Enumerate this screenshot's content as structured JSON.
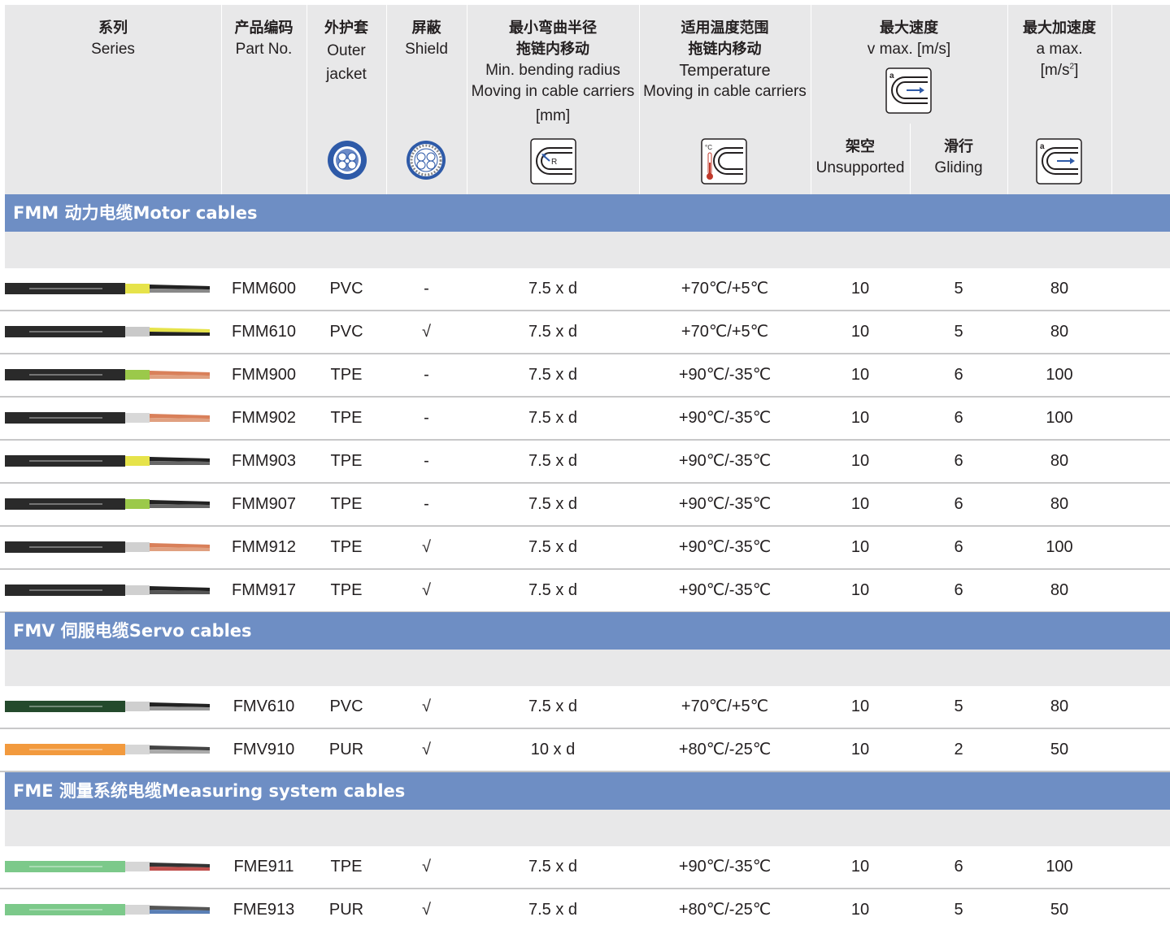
{
  "header": {
    "series": {
      "cn": "系列",
      "en": "Series"
    },
    "part_no": {
      "cn": "产品编码",
      "en": "Part No."
    },
    "outer_jacket": {
      "cn": "外护套",
      "en1": "Outer",
      "en2": "jacket"
    },
    "shield": {
      "cn": "屏蔽",
      "en": "Shield"
    },
    "bending": {
      "cn1": "最小弯曲半径",
      "cn2": "拖链内移动",
      "en1": "Min. bending radius",
      "en2": "Moving in cable carriers",
      "en3": "[mm]"
    },
    "temperature": {
      "cn1": "适用温度范围",
      "cn2": "拖链内移动",
      "en1": "Temperature",
      "en2": "Moving in cable carriers"
    },
    "speed": {
      "cn": "最大速度",
      "en": "v max. [m/s]",
      "unsupported_cn": "架空",
      "unsupported_en": "Unsupported",
      "gliding_cn": "滑行",
      "gliding_en": "Gliding"
    },
    "accel": {
      "cn": "最大加速度",
      "en1": "a max.",
      "en2_a": "[m/s",
      "en2_sup": "2",
      "en2_b": "]"
    }
  },
  "icons": {
    "outer_jacket": "cable-cross-section-icon",
    "shield": "shielded-cable-cross-section-icon",
    "bending": "bending-radius-icon",
    "temperature": "thermometer-cable-carrier-icon",
    "speed": "speed-cable-carrier-icon",
    "accel": "acceleration-cable-carrier-icon",
    "icon_letter_a": "a",
    "icon_letter_r": "R",
    "icon_unit_c": "°C"
  },
  "colors": {
    "header_bg": "#e8e8e9",
    "section_bg": "#6e8ec4",
    "row_separator": "#c8c8c9",
    "icon_blue": "#2e5aa8"
  },
  "sections": [
    {
      "title": "FMM 动力电缆Motor cables",
      "rows": [
        {
          "part": "FMM600",
          "jacket": "PVC",
          "shield": "-",
          "bend": "7.5 x d",
          "temp": "+70℃/+5℃",
          "unsupported": "10",
          "gliding": "5",
          "accel": "80",
          "cable_jacket_color": "#2a2a2a",
          "cable_core_colors": [
            "#e6e34a",
            "#222222",
            "#888888"
          ]
        },
        {
          "part": "FMM610",
          "jacket": "PVC",
          "shield": "√",
          "bend": "7.5 x d",
          "temp": "+70℃/+5℃",
          "unsupported": "10",
          "gliding": "5",
          "accel": "80",
          "cable_jacket_color": "#2a2a2a",
          "cable_core_colors": [
            "#c9c9c9",
            "#e6e34a",
            "#222222"
          ]
        },
        {
          "part": "FMM900",
          "jacket": "TPE",
          "shield": "-",
          "bend": "7.5 x d",
          "temp": "+90℃/-35℃",
          "unsupported": "10",
          "gliding": "6",
          "accel": "100",
          "cable_jacket_color": "#2a2a2a",
          "cable_core_colors": [
            "#9bc94a",
            "#d9805a",
            "#e0a080"
          ]
        },
        {
          "part": "FMM902",
          "jacket": "TPE",
          "shield": "-",
          "bend": "7.5 x d",
          "temp": "+90℃/-35℃",
          "unsupported": "10",
          "gliding": "6",
          "accel": "100",
          "cable_jacket_color": "#2a2a2a",
          "cable_core_colors": [
            "#d8d8d8",
            "#d9805a",
            "#e0a080"
          ]
        },
        {
          "part": "FMM903",
          "jacket": "TPE",
          "shield": "-",
          "bend": "7.5 x d",
          "temp": "+90℃/-35℃",
          "unsupported": "10",
          "gliding": "6",
          "accel": "80",
          "cable_jacket_color": "#2a2a2a",
          "cable_core_colors": [
            "#e6e34a",
            "#222222",
            "#666666"
          ]
        },
        {
          "part": "FMM907",
          "jacket": "TPE",
          "shield": "-",
          "bend": "7.5 x d",
          "temp": "+90℃/-35℃",
          "unsupported": "10",
          "gliding": "6",
          "accel": "80",
          "cable_jacket_color": "#2a2a2a",
          "cable_core_colors": [
            "#9bc94a",
            "#222222",
            "#666666"
          ]
        },
        {
          "part": "FMM912",
          "jacket": "TPE",
          "shield": "√",
          "bend": "7.5 x d",
          "temp": "+90℃/-35℃",
          "unsupported": "10",
          "gliding": "6",
          "accel": "100",
          "cable_jacket_color": "#2a2a2a",
          "cable_core_colors": [
            "#d0d0d0",
            "#d9805a",
            "#e0a080"
          ]
        },
        {
          "part": "FMM917",
          "jacket": "TPE",
          "shield": "√",
          "bend": "7.5 x d",
          "temp": "+90℃/-35℃",
          "unsupported": "10",
          "gliding": "6",
          "accel": "80",
          "cable_jacket_color": "#2a2a2a",
          "cable_core_colors": [
            "#d0d0d0",
            "#222222",
            "#555555"
          ]
        }
      ]
    },
    {
      "title": "FMV 伺服电缆Servo cables",
      "rows": [
        {
          "part": "FMV610",
          "jacket": "PVC",
          "shield": "√",
          "bend": "7.5 x d",
          "temp": "+70℃/+5℃",
          "unsupported": "10",
          "gliding": "5",
          "accel": "80",
          "cable_jacket_color": "#244a2c",
          "cable_core_colors": [
            "#cfcfcf",
            "#222222",
            "#999999"
          ]
        },
        {
          "part": "FMV910",
          "jacket": "PUR",
          "shield": "√",
          "bend": "10 x d",
          "temp": "+80℃/-25℃",
          "unsupported": "10",
          "gliding": "2",
          "accel": "50",
          "cable_jacket_color": "#f29a3e",
          "cable_core_colors": [
            "#d6d6d6",
            "#444444",
            "#aaaaaa"
          ]
        }
      ]
    },
    {
      "title": "FME 测量系统电缆Measuring system cables",
      "rows": [
        {
          "part": "FME911",
          "jacket": "TPE",
          "shield": "√",
          "bend": "7.5 x d",
          "temp": "+90℃/-35℃",
          "unsupported": "10",
          "gliding": "6",
          "accel": "100",
          "cable_jacket_color": "#7cc98a",
          "cable_core_colors": [
            "#d6d6d6",
            "#333333",
            "#c0504d"
          ]
        },
        {
          "part": "FME913",
          "jacket": "PUR",
          "shield": "√",
          "bend": "7.5 x d",
          "temp": "+80℃/-25℃",
          "unsupported": "10",
          "gliding": "5",
          "accel": "50",
          "cable_jacket_color": "#7cc98a",
          "cable_core_colors": [
            "#d6d6d6",
            "#555555",
            "#5a7fb5"
          ]
        }
      ]
    }
  ]
}
